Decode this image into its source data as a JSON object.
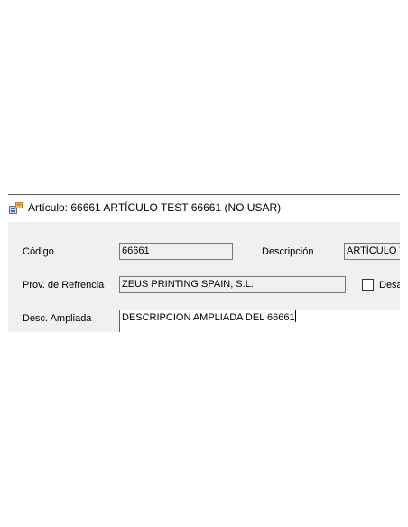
{
  "window": {
    "title": "Artículo: 66661 ARTÍCULO TEST 66661 (NO USAR)"
  },
  "form": {
    "codigo": {
      "label": "Código",
      "value": "66661"
    },
    "descripcion": {
      "label": "Descripción",
      "value": "ARTÍCULO T"
    },
    "proveedor": {
      "label": "Prov. de Refrencia",
      "value": "ZEUS PRINTING SPAIN, S.L."
    },
    "desactivado": {
      "label": "Desa",
      "checked": false
    },
    "desc_ampliada": {
      "label": "Desc. Ampliada",
      "value": "DESCRIPCION AMPLIADA DEL 66661"
    }
  },
  "colors": {
    "client_background": "#f0f0f0",
    "focus_border": "#0078d7",
    "field_border": "#7a7a7a"
  },
  "icons": {
    "window_icon": "app-form-icon"
  }
}
